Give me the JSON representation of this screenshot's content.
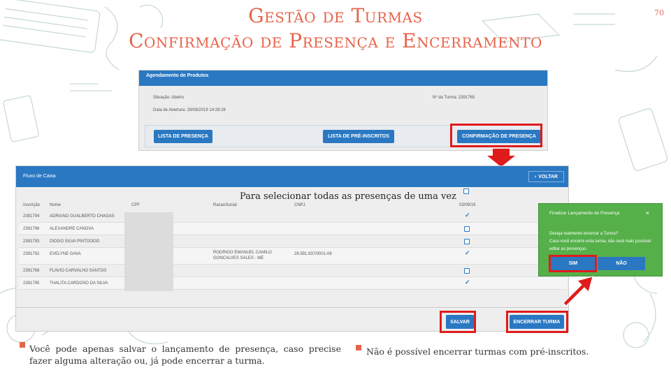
{
  "slide_number": "70",
  "title_line1": "Gestão de Turmas",
  "title_line2": "Confirmação de Presença e Encerramento",
  "screen1": {
    "header": "Agendamento de Produtos",
    "situacao": "Situação: Aberto",
    "data_abertura": "Data de Abertura: 29/08/2019 14:28:28",
    "numero_turma": "Nº da Turma: 2391765",
    "btn_lista_presenca": "LISTA DE PRESENÇA",
    "btn_lista_pre_inscritos": "LISTA DE PRÉ-INSCRITOS",
    "btn_confirmacao": "CONFIRMAÇÃO DE PRESENÇA"
  },
  "screen2": {
    "header": "Fluxo de Caixa",
    "voltar": "VOLTAR",
    "select_all_note": "Para selecionar todas as presenças de uma vez",
    "columns": [
      "Inscrição",
      "Nome",
      "CPF",
      "RazaoSocial",
      "CNPJ",
      "03/09/19"
    ],
    "rows": [
      {
        "inscricao": "2391794",
        "nome": "ADRIANO GUALBERTO CHAGAS",
        "razao1": "",
        "razao2": "",
        "cnpj": "",
        "status": "checked"
      },
      {
        "inscricao": "2391796",
        "nome": "ALEXANDRE CANOVA",
        "razao1": "",
        "razao2": "",
        "cnpj": "",
        "status": "unchecked"
      },
      {
        "inscricao": "2391793",
        "nome": "DIOGO SILVA PINTOOOO",
        "razao1": "",
        "razao2": "",
        "cnpj": "",
        "status": "unchecked"
      },
      {
        "inscricao": "2391792",
        "nome": "EVELYNE GAVA",
        "razao1": "RODRIGO EMANUEL CAMILO",
        "razao2": "GONCALVES SALES - ME",
        "cnpj": "28.591.937/0001-06",
        "status": "checked"
      },
      {
        "inscricao": "2391768",
        "nome": "FLAVIO CARVALHO SANTOS",
        "razao1": "",
        "razao2": "",
        "cnpj": "",
        "status": "unchecked"
      },
      {
        "inscricao": "2391795",
        "nome": "THALITA CARDOSO DA SILVA",
        "razao1": "",
        "razao2": "",
        "cnpj": "",
        "status": "checked"
      }
    ],
    "btn_salvar": "SALVAR",
    "btn_encerrar": "ENCERRAR TURMA"
  },
  "modal": {
    "title": "Finalizar Lançamento de Presença",
    "close": "×",
    "question": "Deseja realmente encerrar a Turma?",
    "warning": "Caso você encerre esta turma, não será mais possível editar as presenças.",
    "btn_sim": "SIM",
    "btn_nao": "NÃO"
  },
  "bullets": {
    "left": "Você pode apenas salvar o lançamento de presença, caso precise fazer alguma alteração ou, já pode encerrar a turma.",
    "right": "Não é possível encerrar turmas com pré-inscritos."
  },
  "colors": {
    "accent": "#e8634a",
    "header_blue": "#2a78c2",
    "highlight_red": "#e01b1b",
    "modal_green": "#56b04a"
  }
}
